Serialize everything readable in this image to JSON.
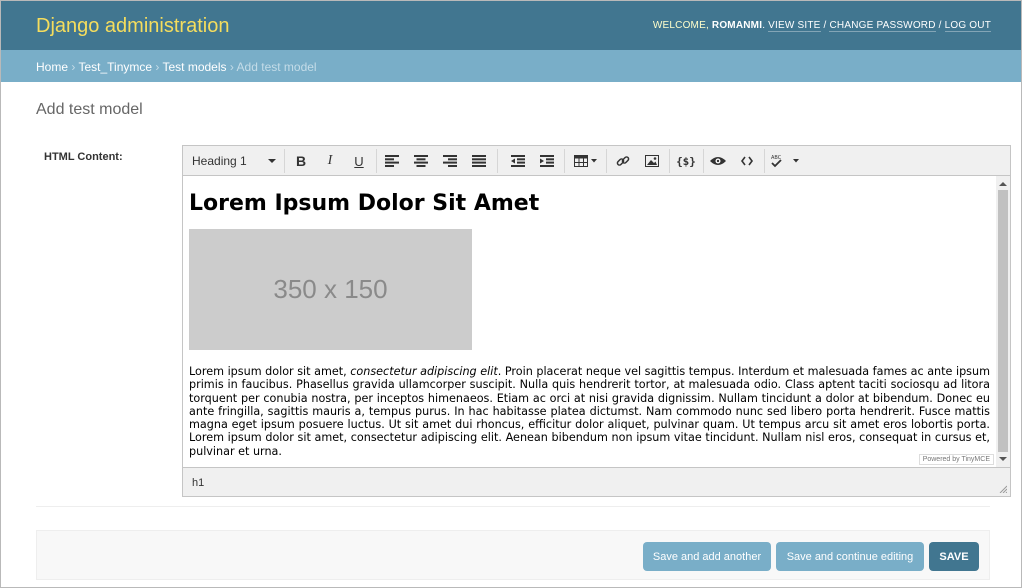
{
  "header": {
    "branding": "Django administration",
    "welcome": "WELCOME, ",
    "username": "ROMANMI",
    "view_site": "VIEW SITE",
    "change_password": "CHANGE PASSWORD",
    "log_out": "LOG OUT",
    "separator": " / ",
    "period": ". "
  },
  "breadcrumbs": {
    "items": [
      "Home",
      "Test_Tinymce",
      "Test models"
    ],
    "current": "Add test model",
    "separator": " › "
  },
  "page": {
    "title": "Add test model",
    "field_label": "HTML Content:"
  },
  "editor": {
    "format_select": "Heading 1",
    "toolbar_icons": [
      "bold-icon",
      "italic-icon",
      "underline-icon",
      "align-left-icon",
      "align-center-icon",
      "align-right-icon",
      "align-justify-icon",
      "outdent-icon",
      "indent-icon",
      "table-icon",
      "link-icon",
      "image-icon",
      "template-icon",
      "preview-icon",
      "code-icon",
      "spellcheck-icon"
    ],
    "heading": "Lorem Ipsum Dolor Sit Amet",
    "image_placeholder": "350 x 150",
    "paragraph_start": "Lorem ipsum dolor sit amet, ",
    "paragraph_italic": "consectetur adipiscing elit",
    "paragraph_rest": ". Proin placerat neque vel sagittis tempus. Interdum et malesuada fames ac ante ipsum primis in faucibus. Phasellus gravida ullamcorper suscipit. Nulla quis hendrerit tortor, at malesuada odio. Class aptent taciti sociosqu ad litora torquent per conubia nostra, per inceptos himenaeos. Etiam ac orci at nisi gravida dignissim. Nullam tincidunt a dolor at bibendum. Donec eu ante fringilla, sagittis mauris a, tempus purus. In hac habitasse platea dictumst. Nam commodo nunc sed libero porta hendrerit. Fusce mattis magna eget ipsum posuere luctus. Ut sit amet dui rhoncus, efficitur dolor aliquet, pulvinar quam. Ut tempus arcu sit amet eros lobortis porta. Lorem ipsum dolor sit amet, consectetur adipiscing elit. Aenean bibendum non ipsum vitae tincidunt. Nullam nisl eros, consequat in cursus et, pulvinar et urna.",
    "powered_by": "Powered by TinyMCE",
    "status_path": "h1"
  },
  "buttons": {
    "save_add_another": "Save and add another",
    "save_continue": "Save and continue editing",
    "save": "SAVE"
  },
  "colors": {
    "header_bg": "#417690",
    "branding": "#f5dd5d",
    "breadcrumbs_bg": "#79aec8",
    "button_secondary": "#79aec8",
    "button_primary": "#417690"
  }
}
